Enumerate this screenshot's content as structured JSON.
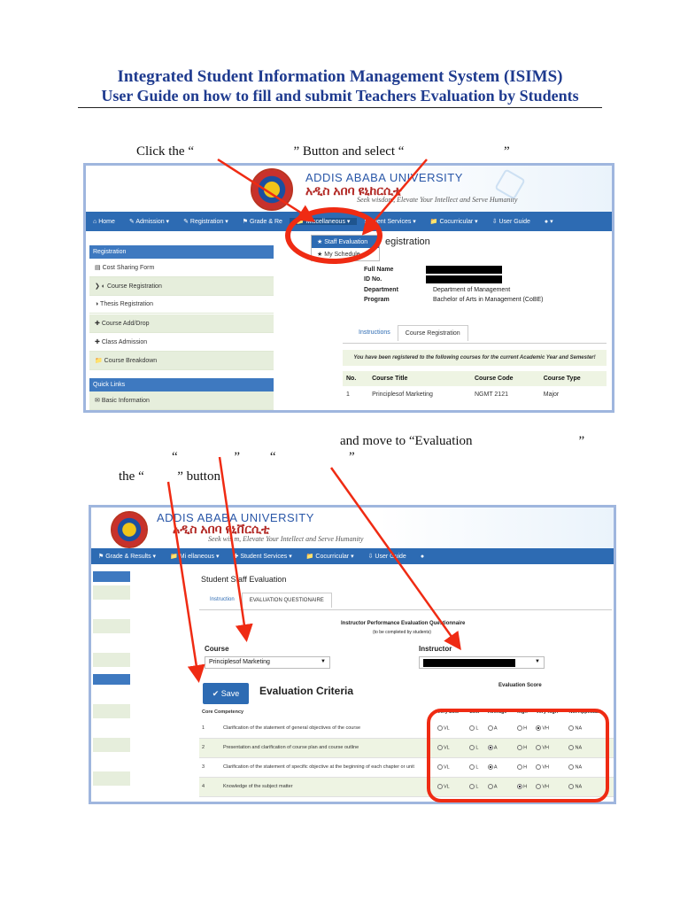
{
  "title_line1": "Integrated Student Information Management System (ISIMS)",
  "title_line2": "User Guide on how to fill and submit Teachers Evaluation by Students",
  "instructions": {
    "step1": "Click the “                              ” Button and select “                              ”",
    "step2": "and move to “Evaluation                                ”",
    "step2b": "“                 ”         “                      ”",
    "step3": "the “          ” button"
  },
  "university": {
    "name_en": "ADDIS ABABA UNIVERSITY",
    "name_am": "አዲስ አበባ ዩኒቨርሲቲ",
    "motto": "Seek wisdom, Elevate Your Intellect and Serve Humanity",
    "motto_partial": "Seek wis   m, Elevate Your Intellect and Serve Humanity",
    "name_en_partial": "ADDIS ABABA U   RSITY",
    "name_am_partial": "አዲስ አበባ ዩኒከርሲቲ"
  },
  "shot1": {
    "nav": [
      "Home",
      "Admission",
      "Registration",
      "Grade & Re",
      "Miscellaneous",
      "Student Services",
      "Cocurricular",
      "User Guide",
      ""
    ],
    "dropdown": [
      "Staff Evaluation",
      "My Schedule"
    ],
    "sidebar_head": "Registration",
    "sidebar_items": [
      "Cost Sharing Form",
      "Course Registration",
      "Thesis Registration",
      "Course Add/Drop",
      "Class Admission",
      "Course Breakdown"
    ],
    "quick_links_head": "Quick Links",
    "quick_links_items": [
      "Basic Information"
    ],
    "page_heading": "egistration",
    "fields": [
      {
        "label": "Full Name",
        "value": ""
      },
      {
        "label": "ID No.",
        "value": ""
      },
      {
        "label": "Department",
        "value": "Department of Management"
      },
      {
        "label": "Program",
        "value": "Bachelor of Arts in Management (CoBE)"
      }
    ],
    "tabs": [
      "Instructions",
      "Course Registration"
    ],
    "notice": "You have been registered to the following courses for the current Academic Year and Semester!",
    "table_headers": [
      "No.",
      "Course Title",
      "Course Code",
      "Course Type"
    ],
    "table_rows": [
      [
        "1",
        "Principlesof Marketing",
        "NGMT 2121",
        "Major"
      ]
    ]
  },
  "shot2": {
    "nav": [
      "Grade & Results",
      "Mi   ellaneous",
      "Student Services",
      "Cocurricular",
      "User Guide",
      ""
    ],
    "page_heading": "Student Staff Evaluation",
    "tabs": [
      "Instruction",
      "EVALUATION QUESTIONAIRE"
    ],
    "questionnaire_title": "Instructor Performance Evaluation Questionnaire",
    "questionnaire_sub": "(to be completed by students)",
    "course_label": "Course",
    "course_value": "Principlesof Marketing",
    "instructor_label": "Instructor",
    "save_label": "✔ Save",
    "eval_criteria": "Evaluation Criteria",
    "score_header": "Evaluation Score",
    "score_columns": [
      "Very Low",
      "Low",
      "Average",
      "high",
      "Very high",
      "Not Applicable"
    ],
    "group_label": "Core Competency",
    "option_codes": [
      "VL",
      "L",
      "A",
      "H",
      "VH",
      "NA"
    ],
    "rows": [
      {
        "no": "1",
        "text": "Clarification of the statement of general objectives of the course",
        "selected": 4
      },
      {
        "no": "2",
        "text": "Presentation and clarification of course plan and course outline",
        "selected": 2
      },
      {
        "no": "3",
        "text": "Clarification of the statement of specific objective at the beginning of each chapter or unit",
        "selected": 2
      },
      {
        "no": "4",
        "text": "Knowledge of the subject matter",
        "selected": 3
      }
    ]
  }
}
